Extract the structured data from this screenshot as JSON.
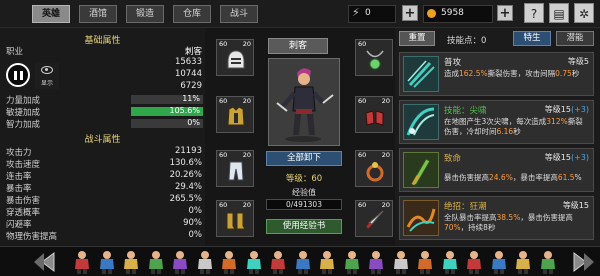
{
  "tabs": [
    {
      "label": "英雄",
      "active": true
    },
    {
      "label": "酒馆",
      "active": false
    },
    {
      "label": "锻造",
      "active": false
    },
    {
      "label": "仓库",
      "active": false
    },
    {
      "label": "战斗",
      "active": false
    }
  ],
  "resources": {
    "energy": {
      "icon": "lightning-icon",
      "value": "0"
    },
    "gold": {
      "icon": "gold-coin-icon",
      "value": "5958"
    }
  },
  "system_buttons": [
    "help-icon",
    "quest-book-icon",
    "settings-gear-icon"
  ],
  "overlay": {
    "eye_label": "显示"
  },
  "stats": {
    "basic_title": "基础属性",
    "rows": [
      {
        "label": "职业",
        "value": "刺客"
      },
      {
        "label": "",
        "value": "15633"
      },
      {
        "label": "",
        "value": "10744"
      },
      {
        "label": "",
        "value": "6729"
      }
    ],
    "bars": [
      {
        "label": "力量加成",
        "value": "11%",
        "fill": 0.11,
        "color": "#3a3a3a"
      },
      {
        "label": "敏捷加成",
        "value": "105.6%",
        "fill": 1.0,
        "color": "#2fa74a"
      },
      {
        "label": "智力加成",
        "value": "0%",
        "fill": 0.0,
        "color": "#3a3a3a"
      }
    ],
    "combat_title": "战斗属性",
    "combat_rows": [
      {
        "label": "攻击力",
        "value": "21193"
      },
      {
        "label": "攻击速度",
        "value": "130.6%"
      },
      {
        "label": "连击率",
        "value": "20.26%"
      },
      {
        "label": "暴击率",
        "value": "29.4%"
      },
      {
        "label": "暴击伤害",
        "value": "265.5%"
      },
      {
        "label": "穿透概率",
        "value": "0%"
      },
      {
        "label": "闪避率",
        "value": "90%"
      },
      {
        "label": "物理伤害提高",
        "value": "0%"
      }
    ]
  },
  "equipment": {
    "character_name": "刺客",
    "unequip_all": "全部卸下",
    "level_text": "等级：60",
    "exp_label": "经验值",
    "exp_value": "0/491303",
    "use_book": "使用经验书",
    "slots": [
      {
        "name": "helmet-icon",
        "level": "60",
        "count": "20",
        "color": "#e8e8e8"
      },
      {
        "name": "body-armor-icon",
        "level": "60",
        "count": "20",
        "color": "#c9a23a"
      },
      {
        "name": "leg-armor-icon",
        "level": "60",
        "count": "20",
        "color": "#dfe6ee"
      },
      {
        "name": "boots-icon",
        "level": "60",
        "count": "20",
        "color": "#c9a23a"
      },
      {
        "name": "amulet-icon",
        "level": "60",
        "count": "",
        "color": "#6fd06f"
      },
      {
        "name": "gloves-icon",
        "level": "60",
        "count": "20",
        "color": "#c23a3a"
      },
      {
        "name": "ring-icon",
        "level": "60",
        "count": "20",
        "color": "#d26a2a"
      },
      {
        "name": "dagger-icon",
        "level": "60",
        "count": "20",
        "color": "#e8e8e8"
      }
    ]
  },
  "skills": {
    "reset_label": "重置",
    "points_label": "技能点：0",
    "subtabs": [
      {
        "label": "特生",
        "active": true
      },
      {
        "label": "潜能",
        "active": false
      }
    ],
    "cards": [
      {
        "name": "普攻",
        "name_color": "#e8e8e8",
        "level": "等级5",
        "plus": "",
        "desc_parts": [
          "造成",
          "162.5%",
          "撕裂伤害，攻击间隔",
          "0.75",
          "秒"
        ],
        "icon": "claw-slash-icon",
        "icon_color": "#3fd0c0"
      },
      {
        "name": "技能：尖啸",
        "name_color": "#4fc34f",
        "level": "等级15",
        "plus": "(+3)",
        "desc_parts": [
          "在地图产生3次尖啸，每次造成",
          "312%",
          "撕裂伤害，冷却时间",
          "6.16",
          "秒"
        ],
        "icon": "shriek-icon",
        "icon_color": "#3fd0c0"
      },
      {
        "name": "致命",
        "name_color": "#d8b04a",
        "level": "等级15",
        "plus": "(+3)",
        "desc_parts": [
          "暴击伤害提高",
          "24.6%",
          "，暴击率提高",
          "61.5",
          "%"
        ],
        "icon": "lethal-strike-icon",
        "icon_color": "#7ac24a"
      },
      {
        "name": "绝招：狂潮",
        "name_color": "#d8b04a",
        "level": "等级15",
        "plus": "",
        "desc_parts": [
          "全队暴击率提高",
          "38.5%",
          "，暴击伤害提高",
          "70%",
          "，持续8秒"
        ],
        "icon": "frenzy-tide-icon",
        "icon_color": "#e08a2a"
      }
    ]
  },
  "bottom": {
    "characters": [
      "hero-archer-icon",
      "hero-warrior-icon",
      "hero-mage-icon",
      "hero-rogue-icon",
      "hero-cleric-icon",
      "hero-knight-icon",
      "hero-assassin-icon",
      "hero-monk-icon",
      "hero-druid-icon",
      "hero-ranger-icon",
      "hero-berserker-icon",
      "hero-paladin-icon",
      "hero-necromancer-icon",
      "hero-samurai-icon",
      "hero-witch-icon",
      "hero-shaman-icon",
      "hero-guardian-icon",
      "hero-reaper-icon",
      "hero-hunter-icon",
      "hero-sage-icon"
    ]
  }
}
